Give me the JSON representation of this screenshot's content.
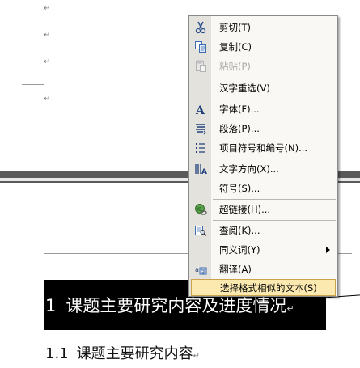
{
  "document": {
    "paragraph_mark": "↵",
    "heading1": {
      "number": "1",
      "text": "课题主要研究内容及进度情况"
    },
    "heading2": {
      "number": "1.1",
      "text": "课题主要研究内容"
    }
  },
  "context_menu": {
    "items": [
      {
        "label": "剪切(T)",
        "icon": "scissors-icon",
        "enabled": true
      },
      {
        "label": "复制(C)",
        "icon": "copy-icon",
        "enabled": true
      },
      {
        "label": "粘贴(P)",
        "icon": "paste-icon",
        "enabled": false
      },
      {
        "label": "汉字重选(V)",
        "icon": "",
        "enabled": true
      },
      {
        "label": "字体(F)...",
        "icon": "font-icon",
        "enabled": true
      },
      {
        "label": "段落(P)...",
        "icon": "paragraph-icon",
        "enabled": true
      },
      {
        "label": "项目符号和编号(N)...",
        "icon": "bullets-icon",
        "enabled": true
      },
      {
        "label": "文字方向(X)...",
        "icon": "text-direction-icon",
        "enabled": true
      },
      {
        "label": "符号(S)...",
        "icon": "",
        "enabled": true
      },
      {
        "label": "超链接(H)...",
        "icon": "hyperlink-icon",
        "enabled": true
      },
      {
        "label": "查阅(K)...",
        "icon": "research-icon",
        "enabled": true
      },
      {
        "label": "同义词(Y)",
        "icon": "",
        "enabled": true,
        "submenu": true
      },
      {
        "label": "翻译(A)",
        "icon": "translate-icon",
        "enabled": true
      },
      {
        "label": "选择格式相似的文本(S)",
        "icon": "",
        "enabled": true,
        "highlighted": true
      }
    ]
  },
  "colors": {
    "menu_background": "#f9f8f4",
    "menu_gutter": "#e4e2dc",
    "highlight_background": "#fbe9b0",
    "highlight_border": "#c9a24a",
    "heading_selection": "#000000"
  }
}
